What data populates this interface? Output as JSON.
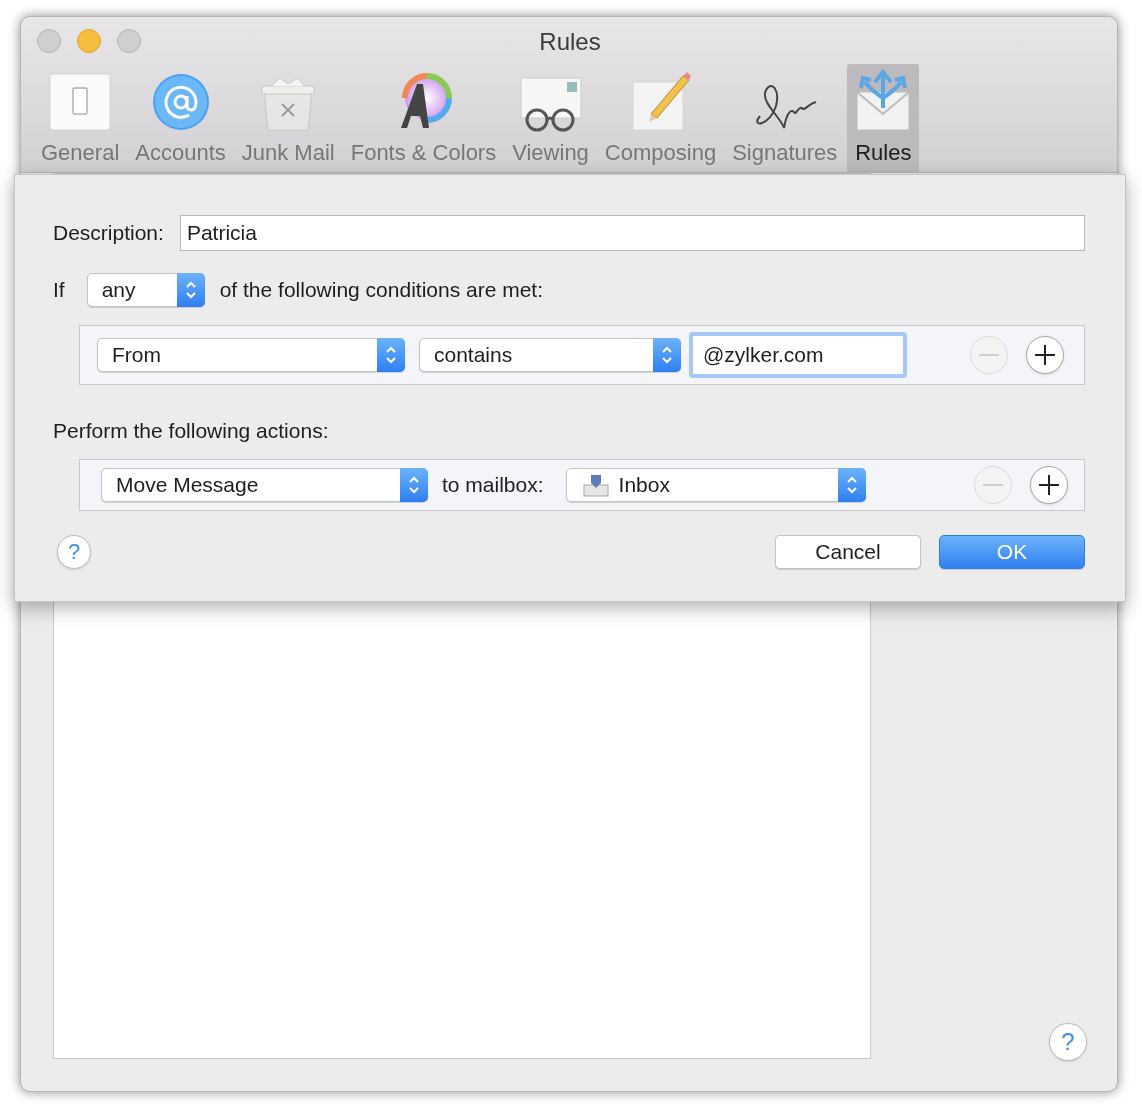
{
  "window": {
    "title": "Rules"
  },
  "toolbar": [
    {
      "label": "General",
      "kind": "general",
      "selected": false
    },
    {
      "label": "Accounts",
      "kind": "accounts",
      "selected": false
    },
    {
      "label": "Junk Mail",
      "kind": "junk",
      "selected": false
    },
    {
      "label": "Fonts & Colors",
      "kind": "fonts",
      "selected": false
    },
    {
      "label": "Viewing",
      "kind": "viewing",
      "selected": false
    },
    {
      "label": "Composing",
      "kind": "composing",
      "selected": false
    },
    {
      "label": "Signatures",
      "kind": "signatures",
      "selected": false
    },
    {
      "label": "Rules",
      "kind": "rules",
      "selected": true
    }
  ],
  "sheet": {
    "description": {
      "label": "Description:",
      "value": "Patricia"
    },
    "condition_match": {
      "prefix": "If",
      "value": "any",
      "suffix": "of the following conditions are met:"
    },
    "conditions": [
      {
        "field": "From",
        "operator": "contains",
        "value": "@zylker.com",
        "focused": true,
        "remove_disabled": true,
        "add_disabled": false
      }
    ],
    "actions_label": "Perform the following actions:",
    "actions": [
      {
        "action": "Move Message",
        "connector": "to mailbox:",
        "target": "Inbox",
        "remove_disabled": true,
        "add_disabled": false
      }
    ],
    "help": "?",
    "buttons": [
      {
        "label": "Cancel",
        "kind": "normal"
      },
      {
        "label": "OK",
        "kind": "default"
      }
    ]
  },
  "window_help": "?"
}
